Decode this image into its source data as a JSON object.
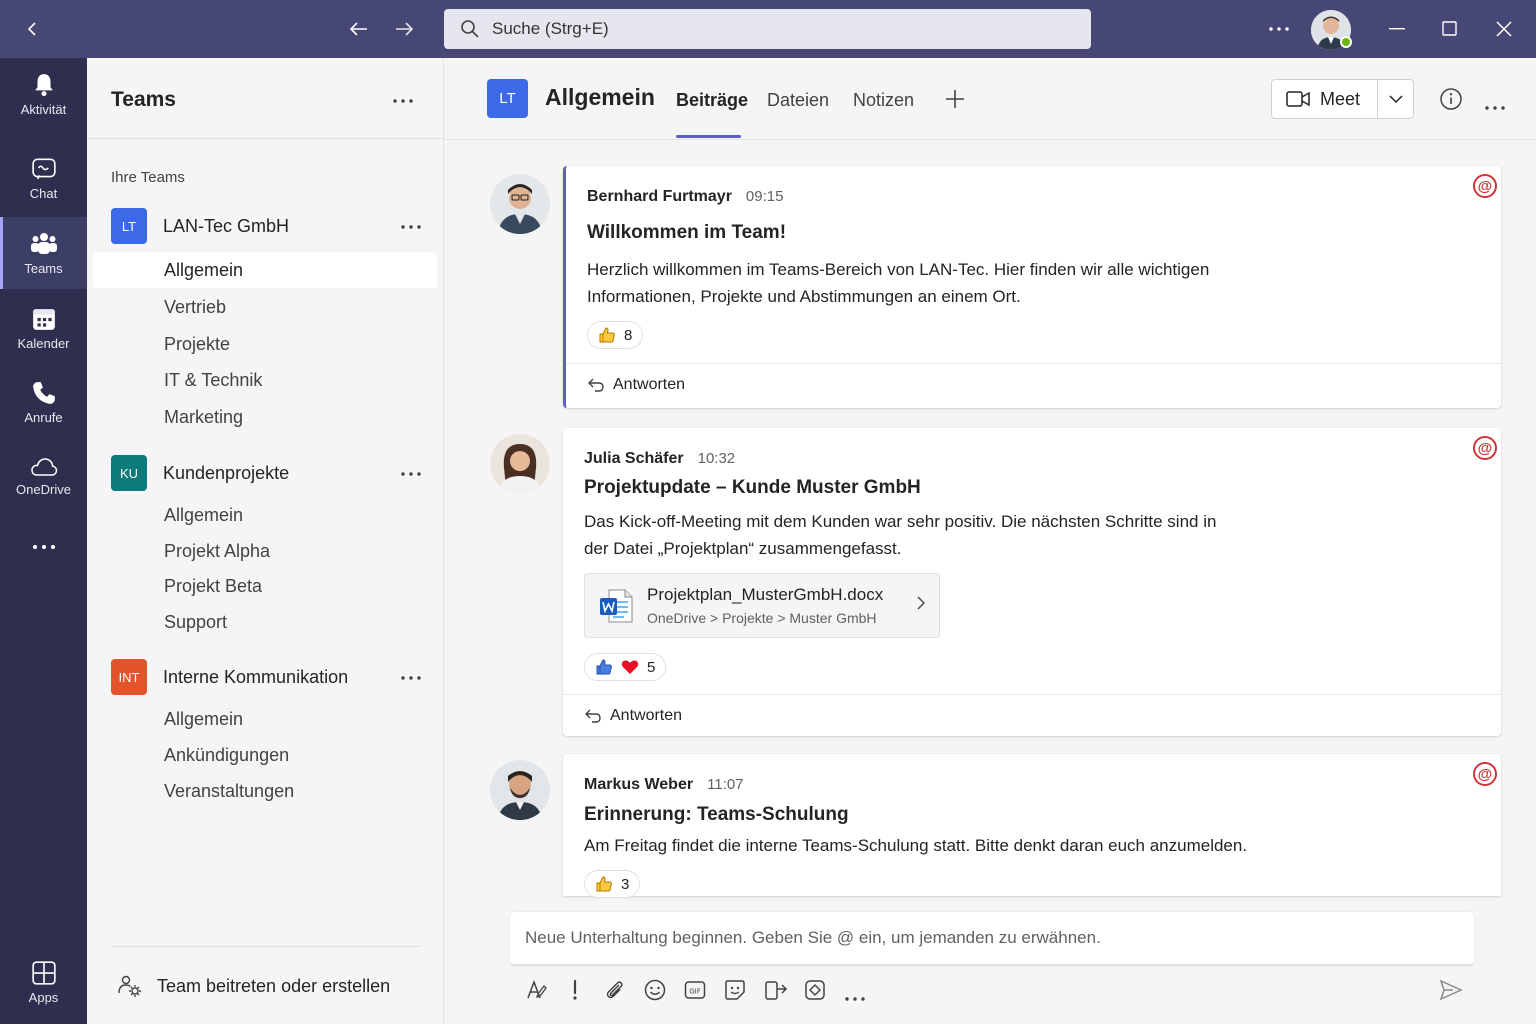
{
  "search": {
    "placeholder": "Suche (Strg+E)"
  },
  "rail": [
    {
      "label": "Aktivität",
      "icon": "bell-icon"
    },
    {
      "label": "Chat",
      "icon": "chat-icon"
    },
    {
      "label": "Teams",
      "icon": "teams-icon"
    },
    {
      "label": "Kalender",
      "icon": "calendar-icon"
    },
    {
      "label": "Anrufe",
      "icon": "phone-icon"
    },
    {
      "label": "OneDrive",
      "icon": "cloud-icon"
    },
    {
      "label": "Apps",
      "icon": "apps-icon"
    }
  ],
  "sidebar": {
    "title": "Teams",
    "section": "Ihre Teams",
    "teams": [
      {
        "initials": "LT",
        "name": "LAN-Tec GmbH",
        "color": "#3b69e8",
        "channels": [
          "Allgemein",
          "Vertrieb",
          "Projekte",
          "IT & Technik",
          "Marketing"
        ]
      },
      {
        "initials": "KU",
        "name": "Kundenprojekte",
        "color": "#0e7a7a",
        "channels": [
          "Allgemein",
          "Projekt Alpha",
          "Projekt Beta",
          "Support"
        ]
      },
      {
        "initials": "INT",
        "name": "Interne Kommunikation",
        "color": "#e3542b",
        "channels": [
          "Allgemein",
          "Ankündigungen",
          "Veranstaltungen"
        ]
      }
    ],
    "footer": "Team beitreten oder erstellen"
  },
  "channel": {
    "initials": "LT",
    "name": "Allgemein",
    "tabs": [
      "Beiträge",
      "Dateien",
      "Notizen"
    ],
    "meet_label": "Meet"
  },
  "messages": [
    {
      "author": "Bernhard Furtmayr",
      "time": "09:15",
      "subject": "Willkommen im Team!",
      "body": "Herzlich willkommen im Teams-Bereich von LAN-Tec. Hier finden wir alle wichtigen Informationen, Projekte und Abstimmungen an einem Ort.",
      "reaction_count": "8",
      "reply": "Antworten"
    },
    {
      "author": "Julia Schäfer",
      "time": "10:32",
      "subject": "Projektupdate – Kunde Muster GmbH",
      "body": "Das Kick-off-Meeting mit dem Kunden war sehr positiv. Die nächsten Schritte sind in der Datei „Projektplan“ zusammengefasst.",
      "file_name": "Projektplan_MusterGmbH.docx",
      "file_path": "OneDrive > Projekte > Muster GmbH",
      "reaction_count": "5",
      "reply": "Antworten"
    },
    {
      "author": "Markus Weber",
      "time": "11:07",
      "subject": "Erinnerung: Teams-Schulung",
      "body": "Am Freitag findet die interne Teams-Schulung statt. Bitte denkt daran euch anzumelden.",
      "reaction_count": "3"
    }
  ],
  "compose": {
    "placeholder": "Neue Unterhaltung beginnen. Geben Sie @ ein, um jemanden zu erwähnen."
  },
  "colors": {
    "titlebar": "#464775",
    "rail": "#2e2f4f",
    "accent": "#5b5fc7",
    "mention": "#d13438",
    "heart": "#e81123",
    "online": "#6bb700"
  }
}
